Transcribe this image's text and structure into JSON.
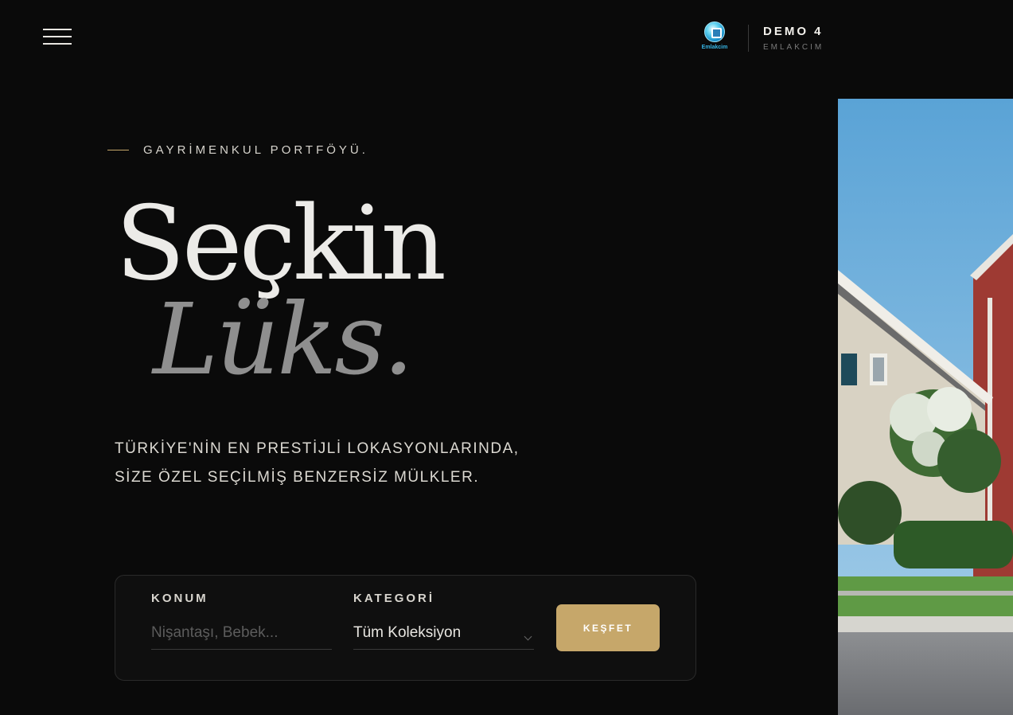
{
  "header": {
    "menu_icon": "hamburger-menu-icon",
    "logo_text": "Emlakcim",
    "brand_title": "DEMO 4",
    "brand_subtitle": "EMLAKCIM"
  },
  "hero": {
    "eyebrow": "GAYRİMENKUL PORTFÖYÜ.",
    "title_line1": "Seçkin",
    "title_line2": "Lüks.",
    "description_line1": "TÜRKİYE'NİN EN PRESTİJLİ LOKASYONLARINDA,",
    "description_line2": "SİZE ÖZEL SEÇİLMİŞ BENZERSİZ MÜLKLER."
  },
  "search": {
    "location_label": "KONUM",
    "location_placeholder": "Nişantaşı, Bebek...",
    "category_label": "KATEGORİ",
    "category_value": "Tüm Koleksiyon",
    "submit_label": "KEŞFET"
  },
  "colors": {
    "background": "#0a0a0a",
    "accent_gold": "#c6a76a",
    "text_primary": "#ecebe8",
    "text_muted": "#8f8f8f"
  }
}
